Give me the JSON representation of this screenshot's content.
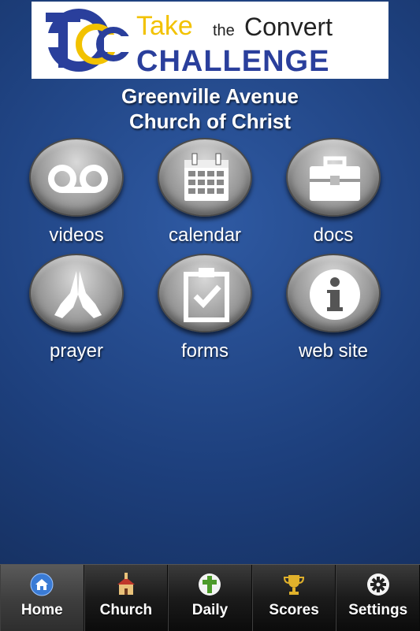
{
  "banner": {
    "logo_letters": "TCC",
    "line1_take": "Take",
    "line1_the": "the",
    "line1_convert": "Convert",
    "line2": "CHALLENGE",
    "colors": {
      "blue": "#2a3f9c",
      "yellow": "#f2c200",
      "text_dark": "#222222"
    }
  },
  "church": {
    "line1": "Greenville Avenue",
    "line2": "Church of Christ"
  },
  "tiles": [
    {
      "label": "videos",
      "icon": "voicemail-icon"
    },
    {
      "label": "calendar",
      "icon": "calendar-icon"
    },
    {
      "label": "docs",
      "icon": "toolbox-icon"
    },
    {
      "label": "prayer",
      "icon": "praying-hands-icon"
    },
    {
      "label": "forms",
      "icon": "clipboard-check-icon"
    },
    {
      "label": "web site",
      "icon": "info-icon"
    }
  ],
  "tabbar": {
    "tabs": [
      {
        "label": "Home",
        "icon": "home-icon",
        "active": true
      },
      {
        "label": "Church",
        "icon": "church-icon",
        "active": false
      },
      {
        "label": "Daily",
        "icon": "cross-icon",
        "active": false
      },
      {
        "label": "Scores",
        "icon": "trophy-icon",
        "active": false
      },
      {
        "label": "Settings",
        "icon": "gear-icon",
        "active": false
      }
    ]
  }
}
